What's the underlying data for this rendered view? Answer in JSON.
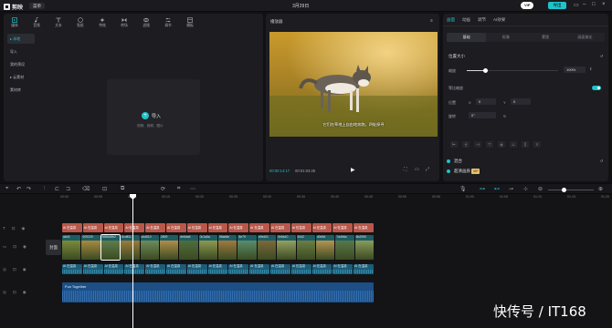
{
  "titlebar": {
    "app_name": "剪映",
    "menu": "菜单",
    "title": "3月29日",
    "vip": "VIP",
    "export": "导出"
  },
  "toolbar_tabs": [
    {
      "label": "媒体",
      "icon": "media-icon"
    },
    {
      "label": "音频",
      "icon": "audio-icon"
    },
    {
      "label": "文本",
      "icon": "text-icon"
    },
    {
      "label": "贴纸",
      "icon": "sticker-icon"
    },
    {
      "label": "特效",
      "icon": "effects-icon"
    },
    {
      "label": "转场",
      "icon": "transition-icon"
    },
    {
      "label": "滤镜",
      "icon": "filter-icon"
    },
    {
      "label": "调节",
      "icon": "adjust-icon"
    },
    {
      "label": "模板",
      "icon": "template-icon"
    }
  ],
  "sidebar": [
    {
      "label": "▸ 本地"
    },
    {
      "label": "导入"
    },
    {
      "label": "我的预设"
    },
    {
      "label": "▸ 云素材"
    },
    {
      "label": "素材库"
    }
  ],
  "import": {
    "label": "导入",
    "sub": "视频、音频、图片"
  },
  "player": {
    "title": "播放器",
    "caption": "它们在草地上自由地奔跑，四处探寻",
    "current_time": "00:00:14:17",
    "duration": "00:01:04:25"
  },
  "right_panel": {
    "tabs": [
      "画面",
      "动画",
      "调节",
      "AI效果"
    ],
    "subtabs": [
      "基础",
      "抠像",
      "蒙版",
      "画面美化"
    ],
    "position_size": "位置大小",
    "scale_label": "缩放",
    "scale_value": "100%",
    "uniform_label": "等比缩放",
    "position_label": "位置",
    "x_label": "X",
    "x_value": "0",
    "y_label": "Y",
    "y_value": "0",
    "rotate_label": "旋转",
    "rotate_value": "0°",
    "blend_label": "混合",
    "hd_label": "超清画质",
    "hd_badge": "VIP"
  },
  "timeline": {
    "ruler": [
      "00:00",
      "00:05",
      "00:10",
      "00:15",
      "00:20",
      "00:25",
      "00:30",
      "00:35",
      "00:40",
      "00:45",
      "00:50",
      "00:55",
      "01:00",
      "01:05",
      "01:10",
      "01:15",
      "01:20"
    ],
    "cover_label": "封面",
    "subtitle_clips": [
      "AI 在温泉",
      "AI 在温泉",
      "AI 在温泉",
      "AI 在温泉",
      "AI 在温泉",
      "AI 在温泉",
      "AI 在温泉",
      "AI 在温泉",
      "AI 在温泉",
      "AI 在温泉",
      "AI 在温泉",
      "AI 在温泉",
      "AI 在温泉",
      "AI 在温泉",
      "AI 在温泉"
    ],
    "video_clips": [
      "a6c5",
      "009229",
      "5656d8b2",
      "5cdff11",
      "cbd810",
      "2809",
      "de6da6",
      "0c1a6a",
      "58ab6e",
      "8e79",
      "c9ed01",
      "0e8a10",
      "52d2",
      "d0e5d",
      "7a4b6a",
      "6b2090"
    ],
    "audio_clips": [
      "AI 在温泉",
      "AI 在温泉",
      "AI 在温泉",
      "AI 在温泉",
      "AI 在温泉",
      "AI 在温泉",
      "AI 在温泉",
      "AI 在温泉",
      "AI 在温泉",
      "AI 在温泉",
      "AI 在温泉",
      "AI 在温泉",
      "AI 在温泉",
      "AI 在温泉",
      "AI 在温泉"
    ],
    "music_clip": "Fun Together"
  },
  "watermark": "快传号 / IT168",
  "colors": {
    "accent": "#1fc3c9",
    "subtitle": "#b9584a",
    "video": "#1b5d63",
    "audio": "#1b5d78",
    "music": "#1b4f86"
  }
}
